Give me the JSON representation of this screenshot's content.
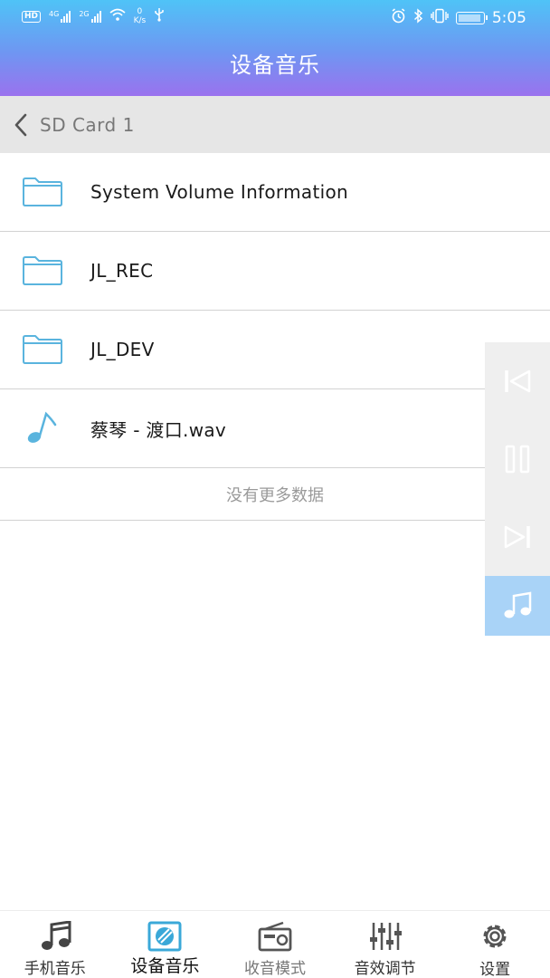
{
  "status_bar": {
    "hd": "HD",
    "sim1": "4G",
    "sim2": "2G",
    "speed_value": "0",
    "speed_unit": "K/s",
    "time": "5:05"
  },
  "header": {
    "title": "设备音乐"
  },
  "breadcrumb": {
    "label": "SD Card 1"
  },
  "files": [
    {
      "name": "System Volume Information",
      "type": "folder",
      "icon": "folder-icon"
    },
    {
      "name": "JL_REC",
      "type": "folder",
      "icon": "folder-icon"
    },
    {
      "name": "JL_DEV",
      "type": "folder",
      "icon": "folder-icon"
    },
    {
      "name": "蔡琴 - 渡口.wav",
      "type": "audio",
      "icon": "music-note-icon"
    }
  ],
  "list_footer": "没有更多数据",
  "player": {
    "buttons": [
      "previous-icon",
      "pause-icon",
      "next-icon",
      "music-note-icon"
    ]
  },
  "tabs": [
    {
      "label": "手机音乐",
      "icon": "music-notes-icon"
    },
    {
      "label": "设备音乐",
      "icon": "sd-card-icon",
      "active": true
    },
    {
      "label": "收音模式",
      "icon": "radio-icon"
    },
    {
      "label": "音效调节",
      "icon": "equalizer-icon"
    },
    {
      "label": "设置",
      "icon": "gear-icon"
    }
  ],
  "colors": {
    "header_gradient": [
      "#4fc3f7",
      "#9a72ee"
    ],
    "accent_blue": "#5ab4de",
    "player_active": "#a9d3f7",
    "breadcrumb_bg": "#e6e6e6"
  }
}
